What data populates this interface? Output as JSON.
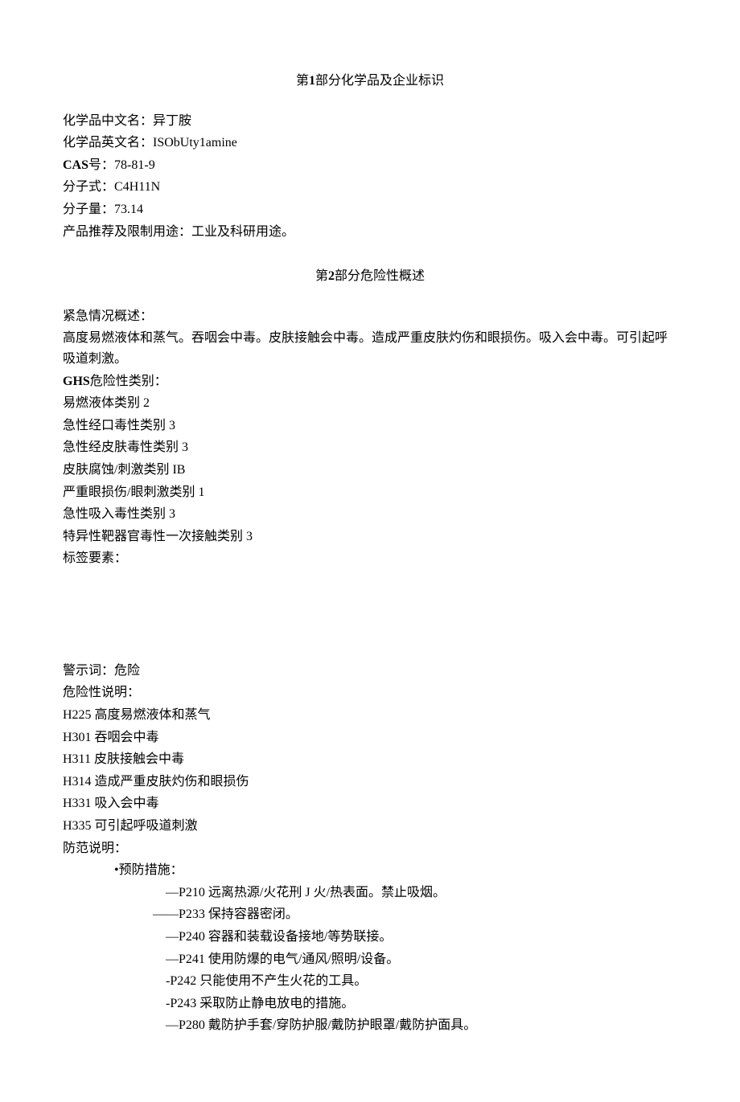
{
  "section1": {
    "title_prefix": "第",
    "title_num": "1",
    "title_suffix": "部分化学品及企业标识",
    "l1_label": "化学品中文名：",
    "l1_value": "异丁胺",
    "l2_label": "化学品英文名：",
    "l2_value": "ISObUty1amine",
    "l3_label": "CAS",
    "l3_mid": "号：",
    "l3_value": "78-81-9",
    "l4_label": "分子式：",
    "l4_value": "C4H11N",
    "l5_label": "分子量：",
    "l5_value": "73.14",
    "l6": "产品推荐及限制用途：工业及科研用途。"
  },
  "section2": {
    "title_prefix": "第",
    "title_num": "2",
    "title_suffix": "部分危险性概述",
    "l1": "紧急情况概述：",
    "l2": "高度易燃液体和蒸气。吞咽会中毒。皮肤接触会中毒。造成严重皮肤灼伤和眼损伤。吸入会中毒。可引起呼吸道刺激。",
    "l3_bold": "GHS",
    "l3_rest": "危险性类别：",
    "cat1": "易燃液体类别 2",
    "cat2": "急性经口毒性类别 3",
    "cat3": "急性经皮肤毒性类别 3",
    "cat4": "皮肤腐蚀/刺激类别 IB",
    "cat5": "严重眼损伤/眼刺激类别 1",
    "cat6": "急性吸入毒性类别 3",
    "cat7": "特异性靶器官毒性一次接触类别 3",
    "l_label": "标签要素：",
    "l_warn": "警示词：危险",
    "l_haz": "危险性说明：",
    "h225": "H225 高度易燃液体和蒸气",
    "h301": "H301 吞咽会中毒",
    "h311": "H311 皮肤接触会中毒",
    "h314": "H314 造成严重皮肤灼伤和眼损伤",
    "h331": "H331 吸入会中毒",
    "h335": "H335 可引起呼吸道刺激",
    "l_prec": "防范说明：",
    "l_prev": "•预防措施：",
    "p210": "—P210 远离热源/火花刑 J 火/热表面。禁止吸烟。",
    "p233": "——P233 保持容器密闭。",
    "p240": "—P240 容器和装载设备接地/等势联接。",
    "p241": "—P241 使用防爆的电气/通风/照明/设备。",
    "p242": "-P242 只能使用不产生火花的工具。",
    "p243": "-P243 采取防止静电放电的措施。",
    "p280": "—P280 戴防护手套/穿防护服/戴防护眼罩/戴防护面具。"
  }
}
